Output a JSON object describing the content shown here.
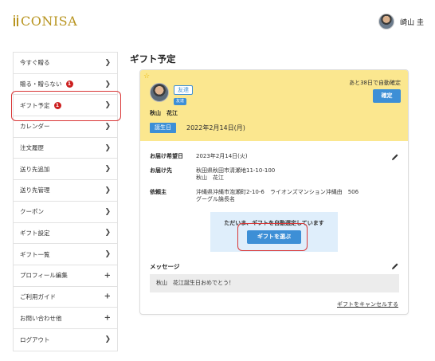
{
  "header": {
    "logo_text": "CONISA",
    "user_name": "崎山 圭"
  },
  "sidebar": {
    "items": [
      {
        "label": "今すぐ贈る",
        "icon": "chevron-right-icon"
      },
      {
        "label": "贈る・贈らない",
        "badge": "1",
        "icon": "chevron-right-icon"
      },
      {
        "label": "ギフト予定",
        "badge": "1",
        "icon": "chevron-right-icon"
      },
      {
        "label": "カレンダー",
        "icon": "chevron-right-icon"
      },
      {
        "label": "注文履歴",
        "icon": "chevron-right-icon"
      },
      {
        "label": "送り先追加",
        "icon": "chevron-right-icon"
      },
      {
        "label": "送り先管理",
        "icon": "chevron-right-icon"
      },
      {
        "label": "クーポン",
        "icon": "chevron-right-icon"
      },
      {
        "label": "ギフト設定",
        "icon": "chevron-right-icon"
      },
      {
        "label": "ギフト一覧",
        "icon": "chevron-right-icon"
      },
      {
        "label": "プロフィール編集",
        "icon": "plus-icon"
      },
      {
        "label": "ご利用ガイド",
        "icon": "plus-icon"
      },
      {
        "label": "お問い合わせ他",
        "icon": "plus-icon"
      },
      {
        "label": "ログアウト",
        "icon": "chevron-right-icon"
      }
    ]
  },
  "main": {
    "title": "ギフト予定",
    "card": {
      "friend_tag": "友達",
      "friend_mini_tag": "友達",
      "recipient_name": "秋山　花江",
      "birthday_tag": "誕生日",
      "birthday_date": "2022年2月14日(月)",
      "auto_confirm_text": "あと38日で自動確定",
      "confirm_button": "確定",
      "delivery_date_label": "お届け希望日",
      "delivery_date_value": "2023年2月14日(火)",
      "delivery_to_label": "お届け先",
      "delivery_to_line1": "秋田県秋田市清瀬地11-10-100",
      "delivery_to_line2": "秋山　花江",
      "requester_label": "依頼主",
      "requester_line1": "沖縄県沖縄市泡瀬町2-10-6　ライオンズマンション沖縄由　506",
      "requester_line2": "グーグル論長名",
      "auto_select_text": "ただいま、ギフトを自動選定しています",
      "choose_gift_button": "ギフトを選ぶ",
      "message_label": "メッセージ",
      "message_text": "秋山　花江誕生日おめでとう！",
      "cancel_link": "ギフトをキャンセルする"
    }
  },
  "colors": {
    "accent_blue": "#3d8fd6",
    "card_header_yellow": "#fbe78f",
    "badge_red": "#cc1f1f",
    "logo_gold": "#b8941f",
    "highlight_red": "#d93636"
  }
}
